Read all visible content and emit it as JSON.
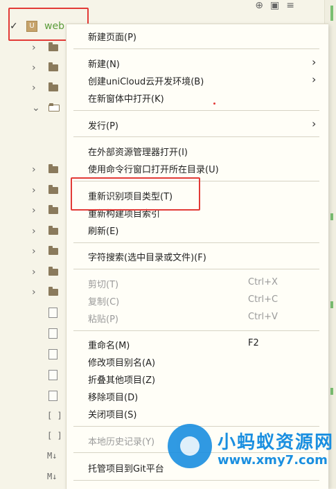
{
  "tree": {
    "root_label": "web",
    "root_check": "✓",
    "project_icon_letter": "U",
    "top_icons": [
      "target-icon",
      "save-icon",
      "menu-icon"
    ]
  },
  "menu": {
    "items": [
      {
        "label": "新建页面(P)"
      },
      {
        "label": "新建(N)",
        "has_submenu": true
      },
      {
        "label": "创建uniCloud云开发环境(B)",
        "has_submenu": true
      },
      {
        "label": "在新窗体中打开(K)"
      },
      {
        "label": "发行(P)",
        "has_submenu": true
      },
      {
        "label": "在外部资源管理器打开(I)"
      },
      {
        "label": "使用命令行窗口打开所在目录(U)"
      },
      {
        "label": "重新识别项目类型(T)"
      },
      {
        "label": "重新构建项目索引"
      },
      {
        "label": "刷新(E)"
      },
      {
        "label": "字符搜索(选中目录或文件)(F)"
      },
      {
        "label": "剪切(T)",
        "shortcut": "Ctrl+X",
        "disabled": true
      },
      {
        "label": "复制(C)",
        "shortcut": "Ctrl+C",
        "disabled": true
      },
      {
        "label": "粘贴(P)",
        "shortcut": "Ctrl+V",
        "disabled": true
      },
      {
        "label": "重命名(M)",
        "shortcut": "F2"
      },
      {
        "label": "修改项目别名(A)"
      },
      {
        "label": "折叠其他项目(Z)"
      },
      {
        "label": "移除项目(D)"
      },
      {
        "label": "关闭项目(S)"
      },
      {
        "label": "本地历史记录(Y)",
        "disabled": true
      },
      {
        "label": "托管项目到Git平台"
      }
    ]
  },
  "watermark": {
    "line1": "小蚂蚁资源网",
    "line2": "www.xmy7.com"
  },
  "colors": {
    "highlight_box": "#e23a36",
    "project_name": "#5a9c3a",
    "watermark": "#1a8fe0"
  }
}
